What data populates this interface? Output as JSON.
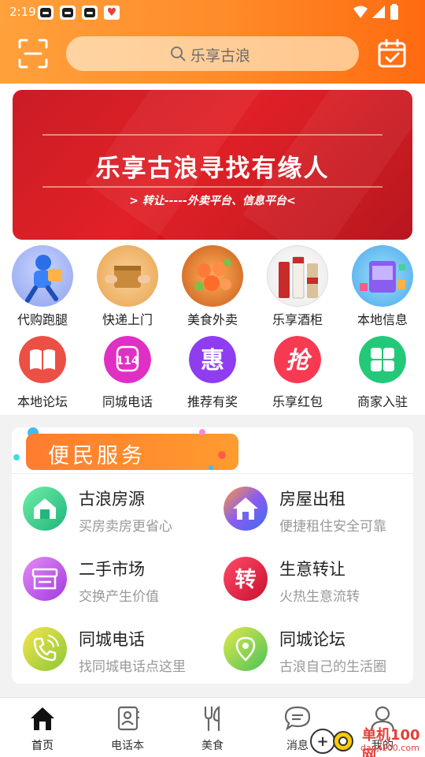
{
  "status": {
    "time": "2:19"
  },
  "search": {
    "placeholder": "乐享古浪"
  },
  "banner": {
    "title": "乐享古浪寻找有缘人",
    "subtitle": "> 转让-----外卖平台、信息平台<"
  },
  "grid_row1": [
    {
      "label": "代购跑腿",
      "icon": "runner-icon"
    },
    {
      "label": "快递上门",
      "icon": "package-icon"
    },
    {
      "label": "美食外卖",
      "icon": "food-icon"
    },
    {
      "label": "乐享酒柜",
      "icon": "liquor-icon"
    },
    {
      "label": "本地信息",
      "icon": "shop-icon"
    }
  ],
  "grid_row2": [
    {
      "label": "本地论坛",
      "icon": "book-icon",
      "glyph": "",
      "color": "#ec4f44"
    },
    {
      "label": "同城电话",
      "icon": "phone-114-icon",
      "glyph": "114",
      "color": "#e02fc4"
    },
    {
      "label": "推荐有奖",
      "icon": "hui-icon",
      "glyph": "惠",
      "color": "#8f3df0"
    },
    {
      "label": "乐享红包",
      "icon": "qiang-icon",
      "glyph": "抢",
      "color": "#f73a52"
    },
    {
      "label": "商家入驻",
      "icon": "clover-icon",
      "glyph": "",
      "color": "#23c978"
    }
  ],
  "services": {
    "title": "便民服务",
    "items": [
      {
        "name": "古浪房源",
        "desc": "买房卖房更省心",
        "icon": "house-icon"
      },
      {
        "name": "房屋出租",
        "desc": "便捷租住安全可靠",
        "icon": "home-icon"
      },
      {
        "name": "二手市场",
        "desc": "交换产生价值",
        "icon": "store-icon"
      },
      {
        "name": "生意转让",
        "desc": "火热生意流转",
        "icon": "zhuan-icon",
        "glyph": "转"
      },
      {
        "name": "同城电话",
        "desc": "找同城电话点这里",
        "icon": "telephone-icon"
      },
      {
        "name": "同城论坛",
        "desc": "古浪自己的生活圈",
        "icon": "location-pin-icon"
      }
    ]
  },
  "tabs": [
    {
      "label": "首页",
      "icon": "home-tab-icon"
    },
    {
      "label": "电话本",
      "icon": "contacts-icon"
    },
    {
      "label": "美食",
      "icon": "utensils-icon"
    },
    {
      "label": "消息",
      "icon": "chat-icon"
    },
    {
      "label": "我的",
      "icon": "user-icon"
    }
  ],
  "watermark": {
    "text": "单机100网",
    "sub": "danji100.com"
  },
  "colors": {
    "header": "#ff8a28",
    "banner": "#d4121a",
    "accent": "#ff7c2e"
  }
}
